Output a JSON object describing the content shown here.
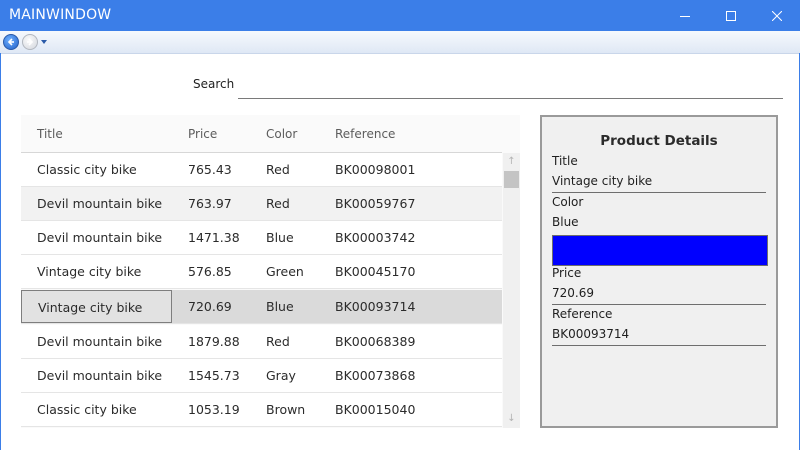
{
  "window": {
    "title": "MAINWINDOW",
    "accent_color": "#3b7ee8",
    "controls": [
      "minimize-icon",
      "maximize-icon",
      "close-icon"
    ]
  },
  "nav": {
    "back_icon": "back-arrow-icon",
    "forward_icon": "forward-arrow-icon",
    "dropdown_icon": "chevron-down-icon"
  },
  "search": {
    "label": "Search",
    "value": "",
    "placeholder": ""
  },
  "grid": {
    "columns": [
      "Title",
      "Price",
      "Color",
      "Reference"
    ],
    "rows": [
      {
        "title": "Classic city bike",
        "price": "765.43",
        "color": "Red",
        "reference": "BK00098001"
      },
      {
        "title": "Devil mountain bike",
        "price": "763.97",
        "color": "Red",
        "reference": "BK00059767"
      },
      {
        "title": "Devil mountain bike",
        "price": "1471.38",
        "color": "Blue",
        "reference": "BK00003742"
      },
      {
        "title": "Vintage city bike",
        "price": "576.85",
        "color": "Green",
        "reference": "BK00045170"
      },
      {
        "title": "Vintage city bike",
        "price": "720.69",
        "color": "Blue",
        "reference": "BK00093714"
      },
      {
        "title": "Devil mountain bike",
        "price": "1879.88",
        "color": "Red",
        "reference": "BK00068389"
      },
      {
        "title": "Devil mountain bike",
        "price": "1545.73",
        "color": "Gray",
        "reference": "BK00073868"
      },
      {
        "title": "Classic city bike",
        "price": "1053.19",
        "color": "Brown",
        "reference": "BK00015040"
      }
    ],
    "selected_row": 4
  },
  "details": {
    "heading": "Product Details",
    "title_label": "Title",
    "title_value": "Vintage city bike",
    "color_label": "Color",
    "color_value": "Blue",
    "color_swatch": "#0000ff",
    "price_label": "Price",
    "price_value": "720.69",
    "reference_label": "Reference",
    "reference_value": "BK00093714"
  }
}
